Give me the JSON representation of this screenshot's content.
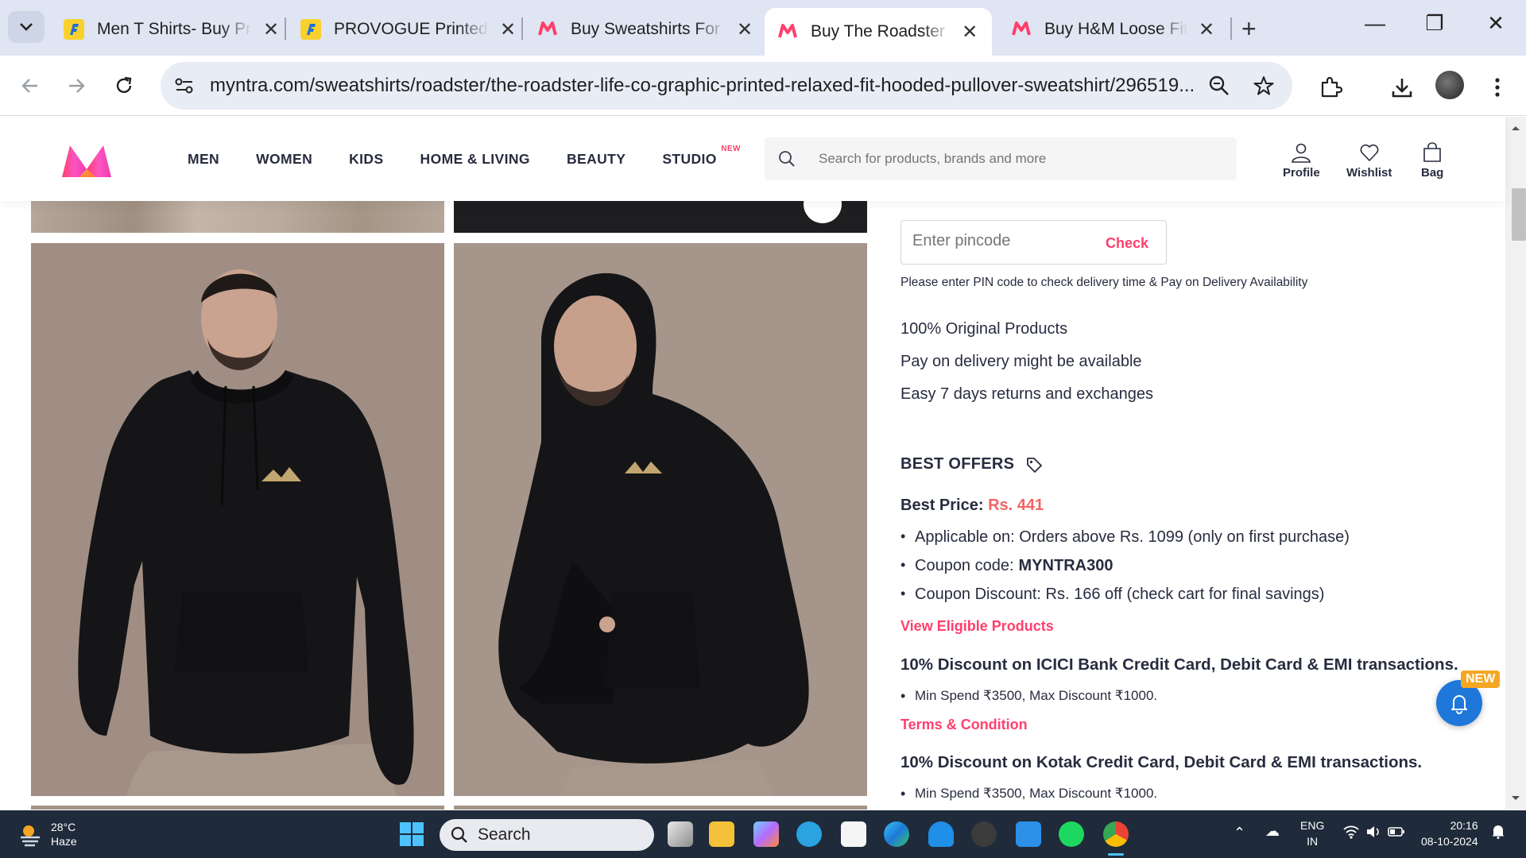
{
  "browser": {
    "tabs": [
      {
        "title": "Men T Shirts- Buy Printed",
        "favicon": "flipkart-icon",
        "active": false
      },
      {
        "title": "PROVOGUE Printed Men",
        "favicon": "flipkart-icon",
        "active": false
      },
      {
        "title": "Buy Sweatshirts For Men",
        "favicon": "myntra-icon",
        "active": false
      },
      {
        "title": "Buy The Roadster Life Co",
        "favicon": "myntra-icon",
        "active": true
      },
      {
        "title": "Buy H&M Loose Fit Hoodie",
        "favicon": "myntra-icon",
        "active": false
      }
    ],
    "url": "myntra.com/sweatshirts/roadster/the-roadster-life-co-graphic-printed-relaxed-fit-hooded-pullover-sweatshirt/296519..."
  },
  "header": {
    "nav": [
      "MEN",
      "WOMEN",
      "KIDS",
      "HOME & LIVING",
      "BEAUTY",
      "STUDIO"
    ],
    "studio_badge": "NEW",
    "search_placeholder": "Search for products, brands and more",
    "profile": "Profile",
    "wishlist": "Wishlist",
    "bag": "Bag"
  },
  "delivery": {
    "pincode_placeholder": "Enter pincode",
    "check": "Check",
    "note": "Please enter PIN code to check delivery time & Pay on Delivery Availability",
    "features": [
      "100% Original Products",
      "Pay on delivery might be available",
      "Easy 7 days returns and exchanges"
    ]
  },
  "offers": {
    "heading": "BEST OFFERS",
    "best_price_label": "Best Price:",
    "best_price_value": "Rs. 441",
    "bullets": {
      "applicable": "Applicable on: Orders above Rs. 1099 (only on first purchase)",
      "coupon_label": "Coupon code:",
      "coupon_code": "MYNTRA300",
      "discount": "Coupon Discount: Rs. 166 off (check cart for final savings)"
    },
    "view_eligible": "View Eligible Products",
    "bank1_title": "10% Discount on ICICI Bank Credit Card, Debit Card & EMI transactions.",
    "bank1_bullet": "Min Spend ₹3500, Max Discount ₹1000.",
    "terms": "Terms & Condition",
    "bank2_title": "10% Discount on Kotak Credit Card, Debit Card & EMI transactions.",
    "bank2_bullet": "Min Spend ₹3500, Max Discount ₹1000."
  },
  "notify": {
    "badge": "NEW"
  },
  "taskbar": {
    "temp": "28°C",
    "weather": "Haze",
    "search": "Search",
    "lang1": "ENG",
    "lang2": "IN",
    "time": "20:16",
    "date": "08-10-2024"
  }
}
